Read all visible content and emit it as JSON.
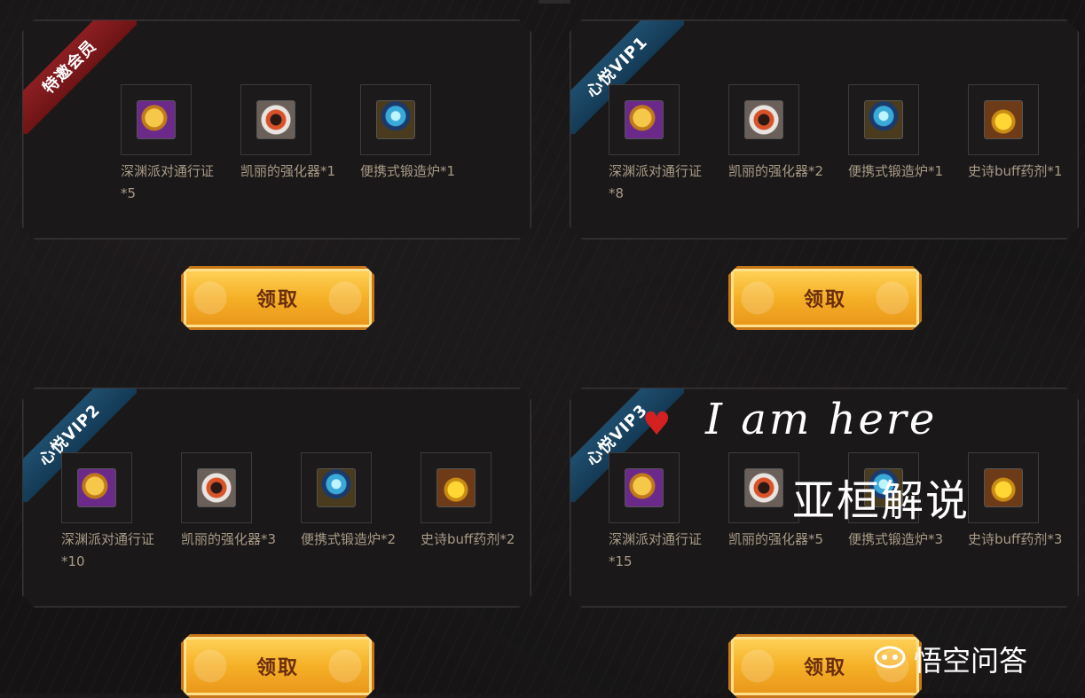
{
  "panels": [
    {
      "ribbon": "特邀会员",
      "ribbon_color": "#7e1a1d",
      "items": [
        {
          "icon": "pass-icon",
          "name": "深渊派对通行证*5"
        },
        {
          "icon": "gear-icon",
          "name": "凯丽的强化器*1"
        },
        {
          "icon": "forge-icon",
          "name": "便携式锻造炉*1"
        }
      ],
      "button": "领取"
    },
    {
      "ribbon": "心悦VIP1",
      "ribbon_color": "#1a4562",
      "items": [
        {
          "icon": "pass-icon",
          "name": "深渊派对通行证*8"
        },
        {
          "icon": "gear-icon",
          "name": "凯丽的强化器*2"
        },
        {
          "icon": "forge-icon",
          "name": "便携式锻造炉*1"
        },
        {
          "icon": "potion-icon",
          "name": "史诗buff药剂*1"
        }
      ],
      "button": "领取"
    },
    {
      "ribbon": "心悦VIP2",
      "ribbon_color": "#1a4562",
      "items": [
        {
          "icon": "pass-icon",
          "name": "深渊派对通行证*10"
        },
        {
          "icon": "gear-icon",
          "name": "凯丽的强化器*3"
        },
        {
          "icon": "forge-icon",
          "name": "便携式锻造炉*2"
        },
        {
          "icon": "potion-icon",
          "name": "史诗buff药剂*2"
        }
      ],
      "button": "领取"
    },
    {
      "ribbon": "心悦VIP3",
      "ribbon_color": "#1a4562",
      "items": [
        {
          "icon": "pass-icon",
          "name": "深渊派对通行证*15"
        },
        {
          "icon": "gear-icon",
          "name": "凯丽的强化器*5"
        },
        {
          "icon": "forge-icon",
          "name": "便携式锻造炉*3"
        },
        {
          "icon": "potion-icon",
          "name": "史诗buff药剂*3"
        }
      ],
      "button": "领取"
    }
  ],
  "overlay": {
    "handwriting": "I am here",
    "watermark": "亚桓解说",
    "logo_text": "悟空问答"
  }
}
